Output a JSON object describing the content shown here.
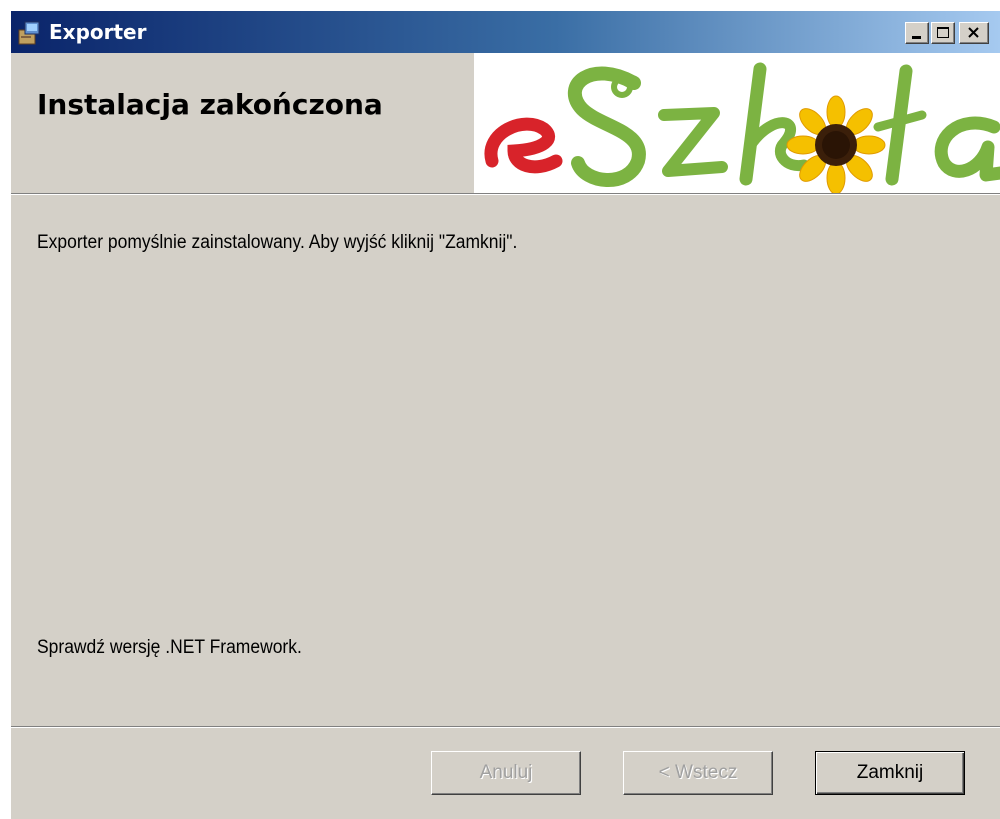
{
  "window": {
    "title": "Exporter",
    "icon": "installer-icon",
    "controls": [
      "minimize-icon",
      "maximize-icon",
      "close-icon"
    ]
  },
  "header": {
    "title": "Instalacja zakończona",
    "logo_text": "eSzkoła"
  },
  "body": {
    "message": "Exporter pomyślnie zainstalowany. Aby wyjść kliknij \"Zamknij\".",
    "note": "Sprawdź wersję .NET Framework."
  },
  "buttons": {
    "cancel": "Anuluj",
    "back": "< Wstecz",
    "close": "Zamknij"
  },
  "colors": {
    "titlebar_start": "#0a246a",
    "titlebar_end": "#a6caf0",
    "dialog_bg": "#d4d0c8",
    "logo_red": "#d8232a",
    "logo_green": "#7cb342",
    "sunflower_yellow": "#f5c000"
  }
}
